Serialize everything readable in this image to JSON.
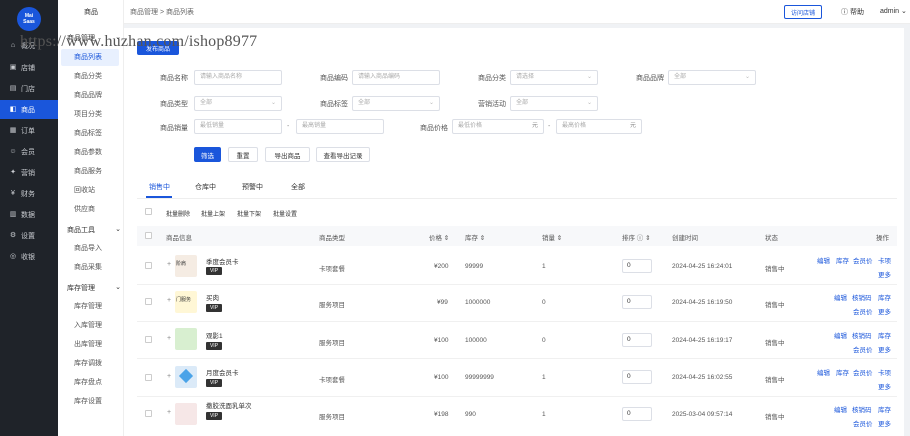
{
  "logo": {
    "line1": "Mai",
    "line2": "Saas"
  },
  "sidebar": {
    "items": [
      {
        "label": "概况",
        "icon": "home-icon"
      },
      {
        "label": "店铺",
        "icon": "store-icon"
      },
      {
        "label": "门店",
        "icon": "shop-icon"
      },
      {
        "label": "商品",
        "icon": "goods-icon"
      },
      {
        "label": "订单",
        "icon": "order-icon"
      },
      {
        "label": "会员",
        "icon": "member-icon"
      },
      {
        "label": "营销",
        "icon": "marketing-icon"
      },
      {
        "label": "财务",
        "icon": "finance-icon"
      },
      {
        "label": "数据",
        "icon": "data-icon"
      },
      {
        "label": "设置",
        "icon": "settings-icon"
      },
      {
        "label": "收银",
        "icon": "cashier-icon"
      }
    ]
  },
  "subnav": {
    "group1": "商品管理",
    "items1": [
      "商品列表",
      "商品分类",
      "商品品牌",
      "项目分类",
      "商品标签",
      "商品参数",
      "商品服务",
      "回收站",
      "供应商"
    ],
    "group2": "商品工具",
    "items2": [
      "商品导入",
      "商品采集"
    ],
    "group3": "库存管理",
    "items3": [
      "库存管理",
      "入库管理",
      "出库管理",
      "库存调拨",
      "库存盘点",
      "库存设置"
    ]
  },
  "topbar": {
    "section": "商品",
    "breadcrumb": "商品管理 > 商品列表",
    "visit_store": "访问店铺",
    "help": "帮助",
    "user": "admin"
  },
  "watermark": "https://www.huzhan.com/ishop8977",
  "add_button": "发布商品",
  "filters": {
    "name_label": "商品名称",
    "name_placeholder": "请输入商品名称",
    "code_label": "商品编码",
    "code_placeholder": "请输入商品编码",
    "category_label": "商品分类",
    "category_value": "请选择",
    "brand_label": "商品品牌",
    "brand_value": "全部",
    "type_label": "商品类型",
    "type_value": "全部",
    "tag_label": "商品标签",
    "tag_value": "全部",
    "promo_label": "营销活动",
    "promo_value": "全部",
    "sales_label": "商品销量",
    "sales_min": "最低销量",
    "sales_max": "最高销量",
    "price_label": "商品价格",
    "price_min": "最低价格",
    "price_max": "最高价格",
    "unit": "元",
    "dash": "-"
  },
  "actions": {
    "filter": "筛选",
    "reset": "重置",
    "export": "导出商品",
    "export_log": "查看导出记录"
  },
  "tabs": [
    "销售中",
    "仓库中",
    "预警中",
    "全部"
  ],
  "bulk": [
    "批量删除",
    "批量上架",
    "批量下架",
    "批量设置"
  ],
  "table": {
    "headers": {
      "info": "商品信息",
      "type": "商品类型",
      "price": "价格 ⇕",
      "stock": "库存 ⇕",
      "sales": "销量 ⇕",
      "sort": "排序 ⓘ ⇕",
      "created": "创建时间",
      "status": "状态",
      "ops": "操作"
    },
    "rows": [
      {
        "name": "季度会员卡",
        "tag": "VIP",
        "thumb_text": "阶肩",
        "type": "卡项套餐",
        "price": "¥200",
        "stock": "99999",
        "sales": "1",
        "sort": "0",
        "created": "2024-04-25 16:24:01",
        "status": "销售中",
        "ops1": [
          "编辑",
          "库存",
          "会员价",
          "卡项"
        ],
        "ops2": [
          "更多"
        ]
      },
      {
        "name": "买肉",
        "tag": "VIP",
        "thumb_text": "门服务",
        "type": "服务项目",
        "price": "¥99",
        "stock": "1000000",
        "sales": "0",
        "sort": "0",
        "created": "2024-04-25 16:19:50",
        "status": "销售中",
        "ops1": [
          "编辑",
          "核销码",
          "库存"
        ],
        "ops2": [
          "会员价",
          "更多"
        ]
      },
      {
        "name": "观影1",
        "tag": "VIP",
        "thumb_text": "",
        "type": "服务项目",
        "price": "¥100",
        "stock": "100000",
        "sales": "0",
        "sort": "0",
        "created": "2024-04-25 16:19:17",
        "status": "销售中",
        "ops1": [
          "编辑",
          "核销码",
          "库存"
        ],
        "ops2": [
          "会员价",
          "更多"
        ]
      },
      {
        "name": "月度会员卡",
        "tag": "VIP",
        "thumb_text": "",
        "type": "卡项套餐",
        "price": "¥100",
        "stock": "99999999",
        "sales": "1",
        "sort": "0",
        "created": "2024-04-25 16:02:55",
        "status": "销售中",
        "ops1": [
          "编辑",
          "库存",
          "会员价",
          "卡项"
        ],
        "ops2": [
          "更多"
        ]
      },
      {
        "name": "撒胶洗面乳单次",
        "tag": "VIP",
        "thumb_text": "",
        "type": "服务项目",
        "price": "¥198",
        "stock": "990",
        "sales": "1",
        "sort": "0",
        "created": "2025-03-04 09:57:14",
        "status": "销售中",
        "ops1": [
          "编辑",
          "核销码",
          "库存"
        ],
        "ops2": [
          "会员价",
          "更多"
        ]
      }
    ]
  },
  "colors": {
    "accent": "#1a56db",
    "sidebar": "#1f2329"
  }
}
